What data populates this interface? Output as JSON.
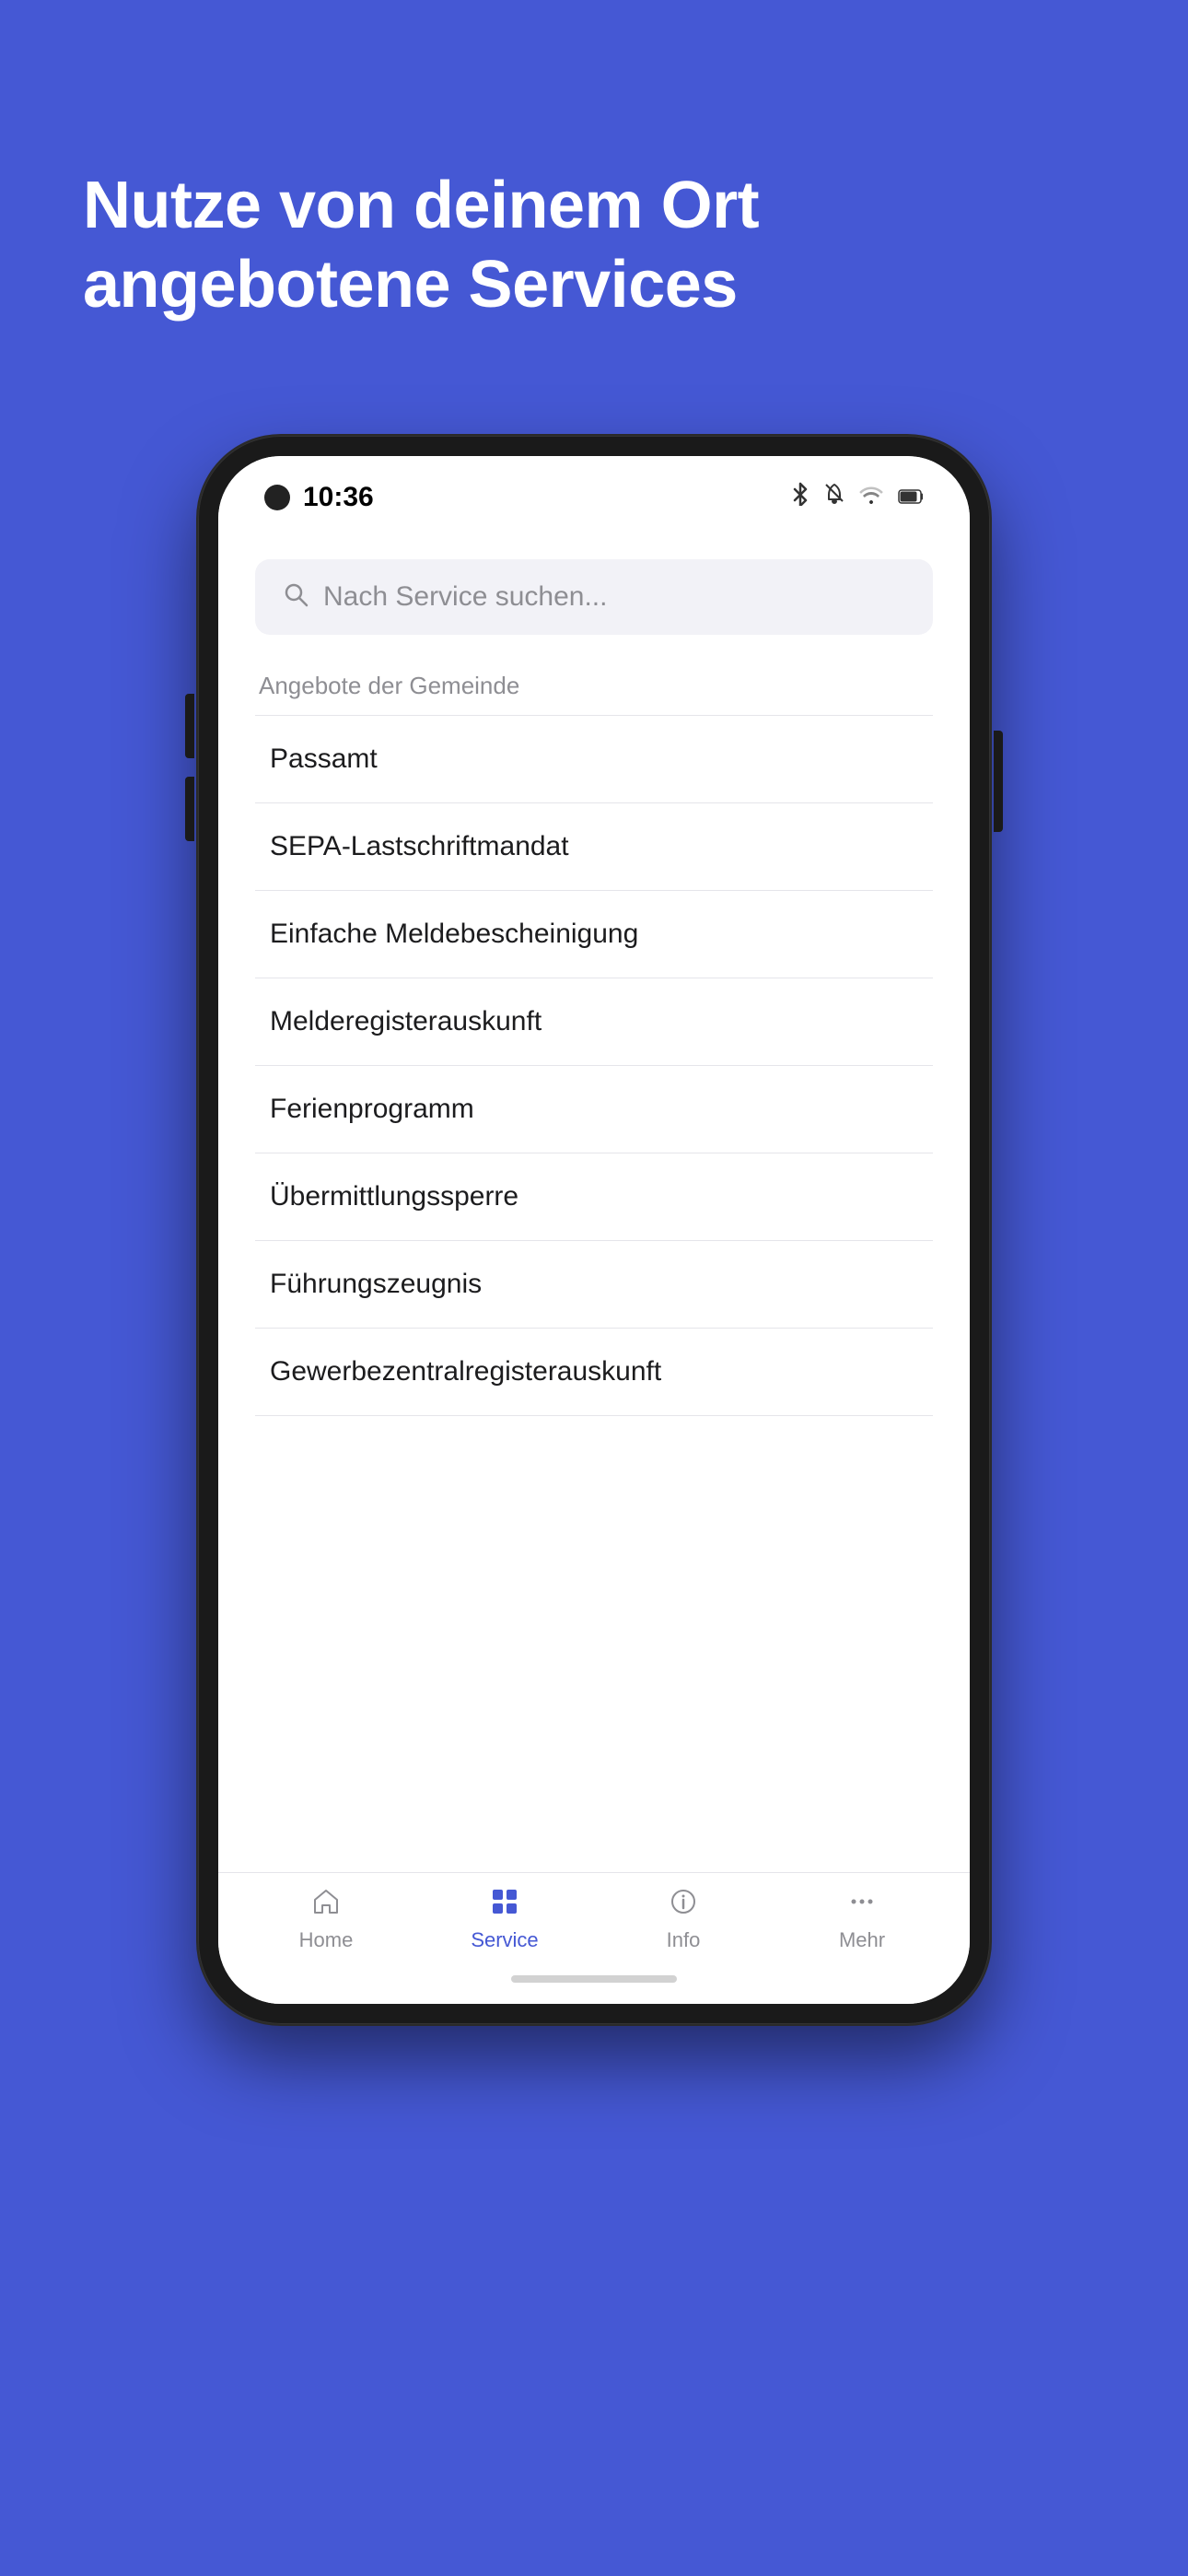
{
  "background_color": "#4558d4",
  "hero": {
    "title": "Nutze von deinem Ort angebotene Services"
  },
  "phone": {
    "status_bar": {
      "time": "10:36"
    },
    "search": {
      "placeholder": "Nach Service suchen..."
    },
    "section_label": "Angebote der Gemeinde",
    "services": [
      {
        "label": "Passamt"
      },
      {
        "label": "SEPA-Lastschriftmandat"
      },
      {
        "label": "Einfache Meldebescheinigung"
      },
      {
        "label": "Melderegisterauskunft"
      },
      {
        "label": "Ferienprogramm"
      },
      {
        "label": "Übermittlungssperre"
      },
      {
        "label": "Führungszeugnis"
      },
      {
        "label": "Gewerbezentralregisterauskunft"
      }
    ],
    "bottom_nav": [
      {
        "label": "Home",
        "active": false
      },
      {
        "label": "Service",
        "active": true
      },
      {
        "label": "Info",
        "active": false
      },
      {
        "label": "Mehr",
        "active": false
      }
    ]
  }
}
